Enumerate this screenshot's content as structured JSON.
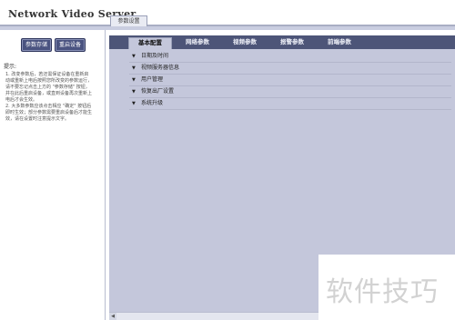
{
  "app": {
    "title": "Network Video Server"
  },
  "top_tabs": [
    {
      "label": "参数设置"
    }
  ],
  "left_panel": {
    "buttons": {
      "save": "参数存储",
      "reboot": "重启设备"
    },
    "tips_title": "提示:",
    "tips": [
      "1. 改变参数后，若还需保证设备在重新启动或重新上电后按照您所改变的参数运行，请不要忘记点击上方的 \"参数存储\" 按钮，并在此后重启设备，或直到设备再次重新上电后才会生效。",
      "2. 大多数参数应该点击相应 \"确定\" 按钮后即时生效；部分参数需要重启设备后才能生效，请在设置时注意提示文字。"
    ]
  },
  "main": {
    "tabs": [
      {
        "label": "基本配置",
        "active": true
      },
      {
        "label": "网络参数",
        "active": false
      },
      {
        "label": "视频参数",
        "active": false
      },
      {
        "label": "报警参数",
        "active": false
      },
      {
        "label": "前端参数",
        "active": false
      }
    ],
    "sections": [
      {
        "label": "日期及时间"
      },
      {
        "label": "视频服务器信息"
      },
      {
        "label": "用户管理"
      },
      {
        "label": "恢复出厂设置"
      },
      {
        "label": "系统升级"
      }
    ]
  },
  "watermark": {
    "text": "软件技巧"
  },
  "colors": {
    "tabbar": "#4d5578",
    "panel": "#c4c7db",
    "button": "#4a5380"
  }
}
